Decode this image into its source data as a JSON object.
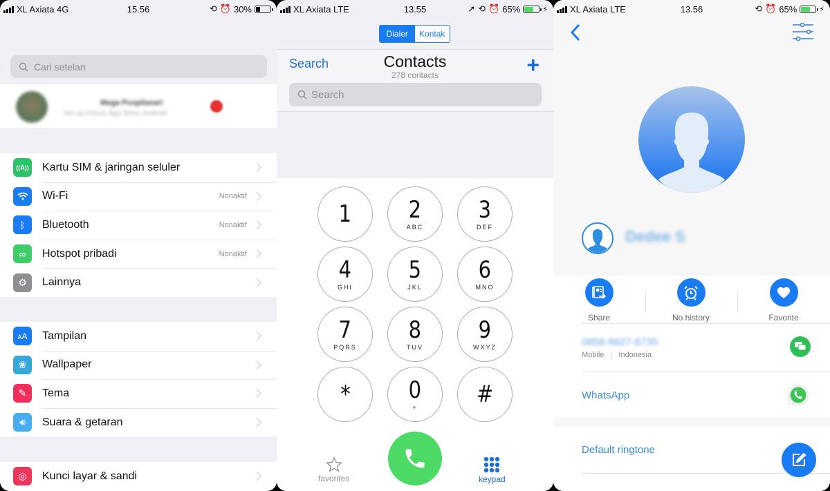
{
  "settings_screen": {
    "status": {
      "carrier": "XL Axiata 4G",
      "time": "15.56",
      "battery": "30%",
      "battery_level": 0.3
    },
    "search": {
      "placeholder": "Cari setelan"
    },
    "profile": {
      "name": "Mega Puspitasari",
      "subtitle": "Set up iCloud, App Store, Android",
      "blurred": true
    },
    "group1": [
      {
        "icon": "cellular-antenna-icon",
        "label": "Kartu SIM & jaringan seluler",
        "value": "",
        "color": "#29c46a"
      },
      {
        "icon": "wifi-icon",
        "label": "Wi-Fi",
        "value": "Nonaktif",
        "color": "#1a7cf4"
      },
      {
        "icon": "bluetooth-icon",
        "label": "Bluetooth",
        "value": "Nonaktif",
        "color": "#1a7cf4"
      },
      {
        "icon": "hotspot-icon",
        "label": "Hotspot pribadi",
        "value": "Nonaktif",
        "color": "#3fcd68"
      },
      {
        "icon": "gear-icon",
        "label": "Lainnya",
        "value": "",
        "color": "#8e8e93"
      }
    ],
    "group2": [
      {
        "icon": "text-size-icon",
        "label": "Tampilan",
        "value": "",
        "color": "#1a7cf4"
      },
      {
        "icon": "flower-icon",
        "label": "Wallpaper",
        "value": "",
        "color": "#36a7d9"
      },
      {
        "icon": "paintbrush-icon",
        "label": "Tema",
        "value": "",
        "color": "#f0305a"
      },
      {
        "icon": "speaker-icon",
        "label": "Suara & getaran",
        "value": "",
        "color": "#46aef0"
      }
    ],
    "group3": [
      {
        "icon": "fingerprint-icon",
        "label": "Kunci layar & sandi",
        "value": "",
        "color": "#f0345a"
      }
    ]
  },
  "dialer_screen": {
    "status": {
      "carrier": "XL Axiata LTE",
      "time": "13.55",
      "battery": "65%",
      "battery_level": 0.65
    },
    "segments": [
      {
        "label": "Dialer",
        "active": true
      },
      {
        "label": "Kontak",
        "active": false
      }
    ],
    "header": {
      "search_link": "Search",
      "title": "Contacts",
      "count": "278 contacts",
      "add": "+"
    },
    "search": {
      "placeholder": "Search"
    },
    "keys": [
      {
        "digit": "1",
        "letters": ""
      },
      {
        "digit": "2",
        "letters": "ABC"
      },
      {
        "digit": "3",
        "letters": "DEF"
      },
      {
        "digit": "4",
        "letters": "GHI"
      },
      {
        "digit": "5",
        "letters": "JKL"
      },
      {
        "digit": "6",
        "letters": "MNO"
      },
      {
        "digit": "7",
        "letters": "PQRS"
      },
      {
        "digit": "8",
        "letters": "TUV"
      },
      {
        "digit": "9",
        "letters": "WXYZ"
      },
      {
        "digit": "*",
        "letters": ""
      },
      {
        "digit": "0",
        "letters": "+"
      },
      {
        "digit": "#",
        "letters": ""
      }
    ],
    "tabs": {
      "favorites": "favorites",
      "keypad": "keypad"
    }
  },
  "contact_screen": {
    "status": {
      "carrier": "XL Axiata LTE",
      "time": "13.56",
      "battery": "65%",
      "battery_level": 0.65
    },
    "contact_name": "Dedee S",
    "actions": [
      {
        "icon": "share-contact-icon",
        "label": "Share"
      },
      {
        "icon": "alarm-clock-icon",
        "label": "No history"
      },
      {
        "icon": "heart-icon",
        "label": "Favorite"
      }
    ],
    "phone": {
      "number": "0858-8827-6735",
      "type": "Mobile",
      "region": "Indonesia",
      "separator": "|"
    },
    "whatsapp_label": "WhatsApp",
    "ringtone_label": "Default ringtone"
  }
}
